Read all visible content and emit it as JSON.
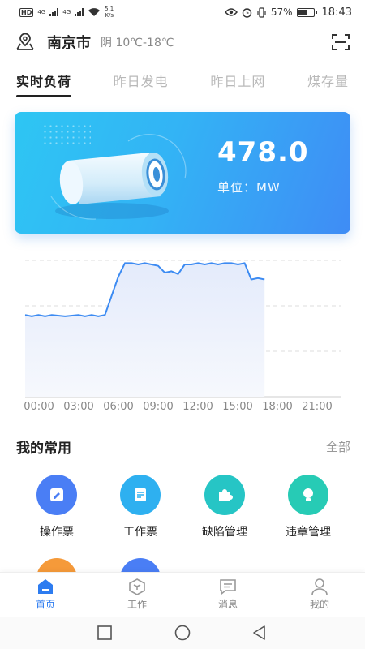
{
  "statusbar": {
    "hd": "HD",
    "net1": "4G",
    "net2": "4G",
    "speed_value": "5.1",
    "speed_unit": "K/s",
    "battery": "57%",
    "time": "18:43"
  },
  "header": {
    "city": "南京市",
    "weather": "阴 10℃-18℃"
  },
  "tabs": [
    {
      "label": "实时负荷",
      "active": true
    },
    {
      "label": "昨日发电",
      "active": false
    },
    {
      "label": "昨日上网",
      "active": false
    },
    {
      "label": "煤存量",
      "active": false
    }
  ],
  "card": {
    "value": "478.0",
    "unit_label": "单位：MW"
  },
  "chart_data": {
    "type": "area",
    "x_ticks": [
      "00:00",
      "03:00",
      "06:00",
      "09:00",
      "12:00",
      "15:00",
      "18:00",
      "21:00"
    ],
    "x_range_hours": [
      0,
      24
    ],
    "grid": "horizontal dashed",
    "color": "#3d8bf2",
    "fill": "#e8eefc",
    "points": [
      [
        0.0,
        0.6
      ],
      [
        0.5,
        0.59
      ],
      [
        1.0,
        0.6
      ],
      [
        1.5,
        0.59
      ],
      [
        2.0,
        0.6
      ],
      [
        3.0,
        0.59
      ],
      [
        4.0,
        0.6
      ],
      [
        4.5,
        0.59
      ],
      [
        5.0,
        0.6
      ],
      [
        5.5,
        0.59
      ],
      [
        6.0,
        0.6
      ],
      [
        7.0,
        0.88
      ],
      [
        7.5,
        0.98
      ],
      [
        8.0,
        0.98
      ],
      [
        8.5,
        0.97
      ],
      [
        9.0,
        0.98
      ],
      [
        9.5,
        0.97
      ],
      [
        10.0,
        0.96
      ],
      [
        10.5,
        0.91
      ],
      [
        11.0,
        0.92
      ],
      [
        11.5,
        0.9
      ],
      [
        12.0,
        0.97
      ],
      [
        12.5,
        0.97
      ],
      [
        13.0,
        0.98
      ],
      [
        13.5,
        0.97
      ],
      [
        14.0,
        0.98
      ],
      [
        14.5,
        0.97
      ],
      [
        15.0,
        0.98
      ],
      [
        15.5,
        0.98
      ],
      [
        16.0,
        0.97
      ],
      [
        16.5,
        0.98
      ],
      [
        17.0,
        0.86
      ],
      [
        17.5,
        0.87
      ],
      [
        18.0,
        0.86
      ]
    ]
  },
  "common": {
    "title": "我的常用",
    "all_label": "全部",
    "items": [
      {
        "label": "操作票",
        "color": "#4a7ef5",
        "icon": "pen-note-icon"
      },
      {
        "label": "工作票",
        "color": "#2eb0f0",
        "icon": "ticket-icon"
      },
      {
        "label": "缺陷管理",
        "color": "#26c5c5",
        "icon": "puzzle-icon"
      },
      {
        "label": "违章管理",
        "color": "#27cbb5",
        "icon": "bulb-icon"
      }
    ],
    "partial_colors": [
      "#f59a3a",
      "#4a7ef5"
    ]
  },
  "bottom_nav": [
    {
      "label": "首页",
      "icon": "home-icon",
      "active": true
    },
    {
      "label": "工作",
      "icon": "cube-icon",
      "active": false
    },
    {
      "label": "消息",
      "icon": "message-icon",
      "active": false
    },
    {
      "label": "我的",
      "icon": "user-icon",
      "active": false
    }
  ]
}
